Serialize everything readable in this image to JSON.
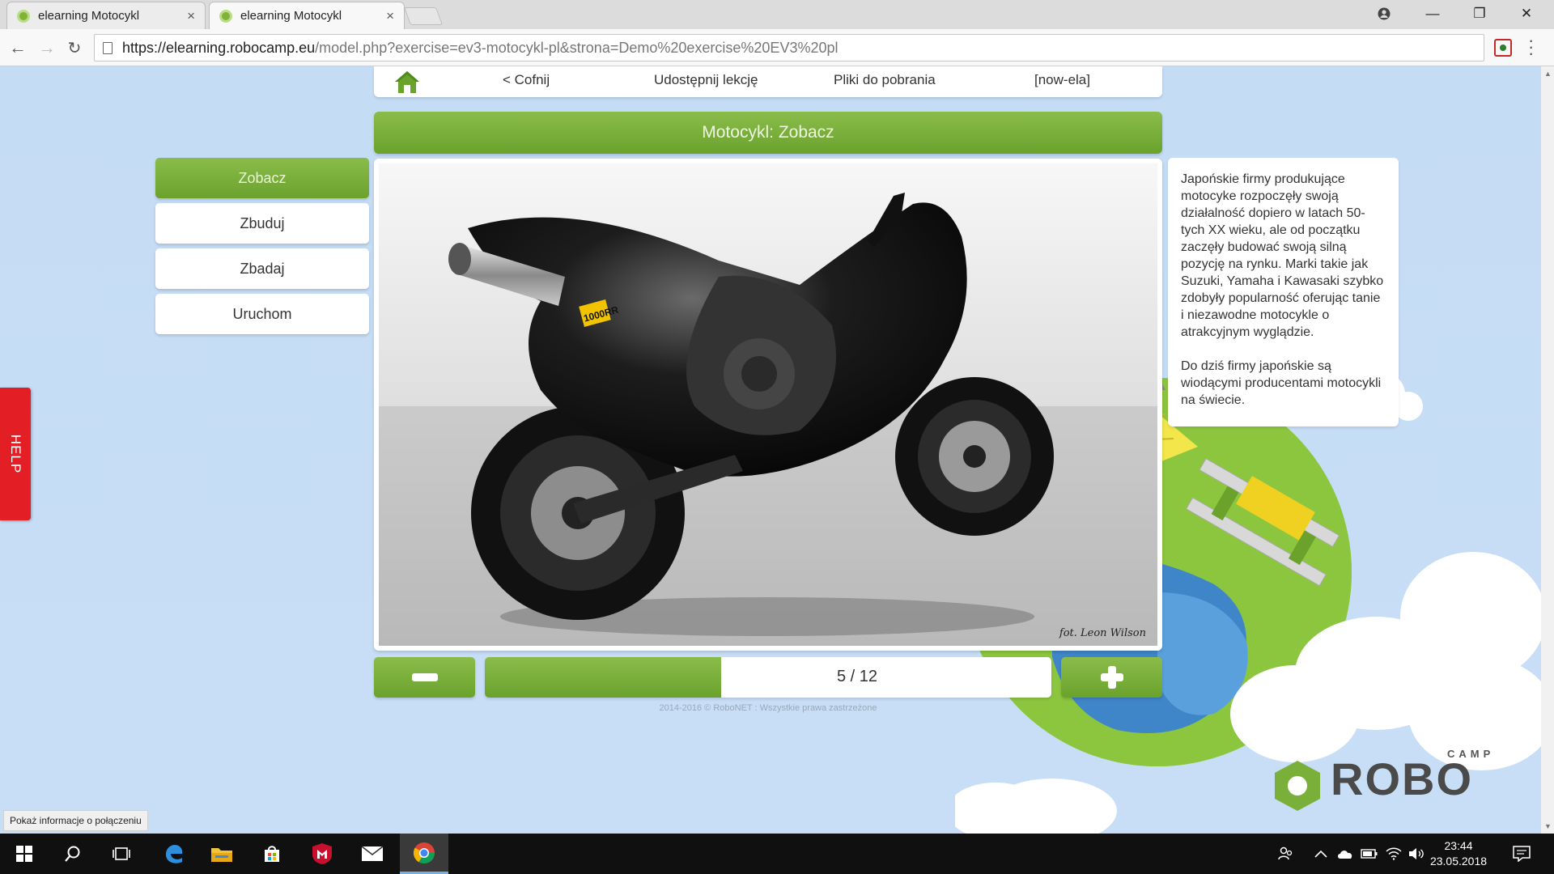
{
  "browser": {
    "tabs": [
      {
        "title": "elearning Motocykl",
        "close": "×"
      },
      {
        "title": "elearning Motocykl",
        "close": "×"
      }
    ],
    "window_controls": {
      "minimize": "—",
      "restore": "❐",
      "close": "✕"
    },
    "url_domain": "https://elearning.robocamp.eu",
    "url_rest": "/model.php?exercise=ev3-motocykl-pl&strona=Demo%20exercise%20EV3%20pl"
  },
  "nav": {
    "back": "< Cofnij",
    "share": "Udostępnij lekcję",
    "downloads": "Pliki do pobrania",
    "user": "[now-ela]"
  },
  "title": "Motocykl: Zobacz",
  "sidebar": {
    "items": [
      {
        "label": "Zobacz",
        "active": true
      },
      {
        "label": "Zbuduj",
        "active": false
      },
      {
        "label": "Zbadaj",
        "active": false
      },
      {
        "label": "Uruchom",
        "active": false
      }
    ]
  },
  "help_tab": "HELP",
  "photo": {
    "credit": "fot. Leon Wilson",
    "plate": "1000RR"
  },
  "info": {
    "paragraph1": "Japońskie firmy produkujące motocyke rozpoczęły swoją działalność dopiero w latach 50-tych XX wieku, ale od początku zaczęły budować swoją silną pozycję na rynku. Marki takie jak Suzuki, Yamaha i Kawasaki szybko zdobyły popularność oferując tanie i niezawodne motocykle o atrakcyjnym wyglądzie.",
    "paragraph2": "Do dziś firmy japońskie są wiodącymi producentami motocykli na świecie."
  },
  "pager": {
    "current": 5,
    "total": 12,
    "label": "5 / 12"
  },
  "copyright": "2014-2016 © RoboNET : Wszystkie prawa zastrzeżone",
  "status_hint": "Pokaż informacje o połączeniu",
  "logo": {
    "camp": "CAMP",
    "robo": "ROBO"
  },
  "taskbar": {
    "time": "23:44",
    "date": "23.05.2018",
    "apps": [
      "start-icon",
      "search-icon",
      "task-view-icon",
      "edge-icon",
      "file-explorer-icon",
      "store-icon",
      "mcafee-icon",
      "mail-icon",
      "chrome-icon"
    ]
  },
  "colors": {
    "accent_green": "#7ab03a",
    "help_red": "#e31e24",
    "page_bg": "#c5dcf5"
  }
}
